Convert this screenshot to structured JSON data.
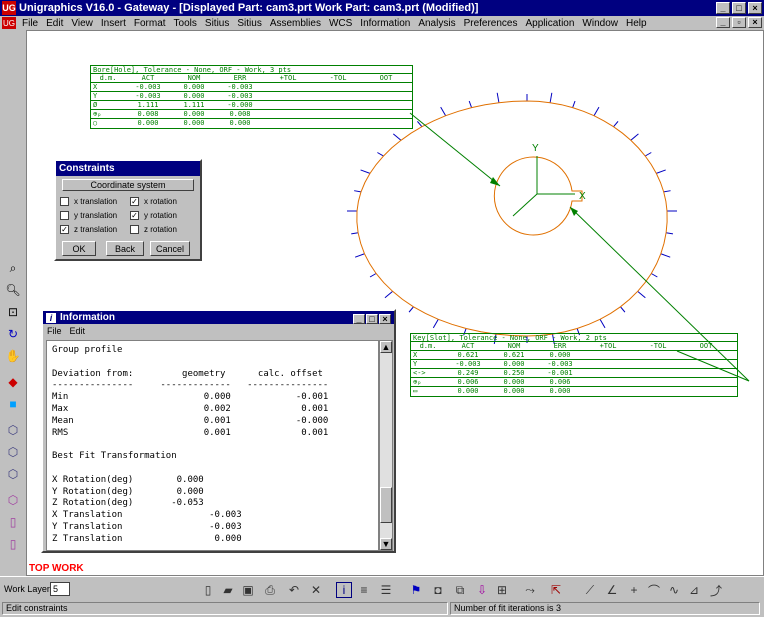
{
  "window": {
    "title": "Unigraphics V16.0 - Gateway - [Displayed Part: cam3.prt   Work Part: cam3.prt (Modified)]"
  },
  "menu": [
    "File",
    "Edit",
    "View",
    "Insert",
    "Format",
    "Tools",
    "Sitius",
    "Sitius",
    "Assemblies",
    "WCS",
    "Information",
    "Analysis",
    "Preferences",
    "Application",
    "Window",
    "Help"
  ],
  "bore_table": {
    "title": "Bore[Hole], Tolerance - None, ORF - Work, 3 pts",
    "headers": [
      "d.m.",
      "ACT",
      "NOM",
      "ERR",
      "+TOL",
      "-TOL",
      "OOT"
    ],
    "rows": [
      [
        "X",
        "-0.003",
        "0.000",
        "-0.003"
      ],
      [
        "Y",
        "-0.003",
        "0.000",
        "-0.003"
      ],
      [
        "Ø",
        "1.111",
        "1.111",
        "-0.000"
      ],
      [
        "⊕ₚ",
        "0.008",
        "0.000",
        "0.008"
      ],
      [
        "○",
        "0.000",
        "0.000",
        "0.000"
      ]
    ]
  },
  "key_table": {
    "title": "Key[Slot], Tolerance - None, ORF - Work, 2 pts",
    "headers": [
      "d.m.",
      "ACT",
      "NOM",
      "ERR",
      "+TOL",
      "-TOL",
      "OOT"
    ],
    "rows": [
      [
        "X",
        "0.621",
        "0.621",
        "0.000"
      ],
      [
        "Y",
        "-0.003",
        "0.000",
        "-0.003"
      ],
      [
        "<->",
        "0.249",
        "0.250",
        "-0.001"
      ],
      [
        "⊕ₚ",
        "0.006",
        "0.000",
        "0.006"
      ],
      [
        "▭",
        "0.000",
        "0.000",
        "0.000"
      ]
    ]
  },
  "axis": {
    "x": "X",
    "y": "Y"
  },
  "constraints": {
    "title": "Constraints",
    "coord_button": "Coordinate system",
    "options": [
      {
        "label": "x translation",
        "checked": false
      },
      {
        "label": "x rotation",
        "checked": true
      },
      {
        "label": "y translation",
        "checked": false
      },
      {
        "label": "y rotation",
        "checked": true
      },
      {
        "label": "z translation",
        "checked": true
      },
      {
        "label": "z rotation",
        "checked": false
      }
    ],
    "ok": "OK",
    "back": "Back",
    "cancel": "Cancel"
  },
  "information": {
    "title": "Information",
    "menu": [
      "File",
      "Edit"
    ],
    "lines": [
      "Group profile",
      "",
      "Deviation from:         geometry      calc. offset",
      "---------------     -------------   ---------------",
      "Min                         0.000            -0.001",
      "Max                         0.002             0.001",
      "Mean                        0.001            -0.000",
      "RMS                         0.001             0.001",
      "",
      "Best Fit Transformation",
      "",
      "X Rotation(deg)        0.000",
      "Y Rotation(deg)        0.000",
      "Z Rotation(deg)       -0.053",
      "X Translation                -0.003",
      "Y Translation                -0.003",
      "Z Translation                 0.000"
    ]
  },
  "view_label": "TOP WORK",
  "work_layer": {
    "label": "Work Layer",
    "value": "5"
  },
  "status": {
    "left": "Edit constraints",
    "right": "Number of fit iterations is 3"
  },
  "colors": {
    "titlebar": "#000080",
    "profile": "#e07000",
    "measure": "#008000",
    "ticks": "#0000c0",
    "view_label": "#ff0000"
  }
}
